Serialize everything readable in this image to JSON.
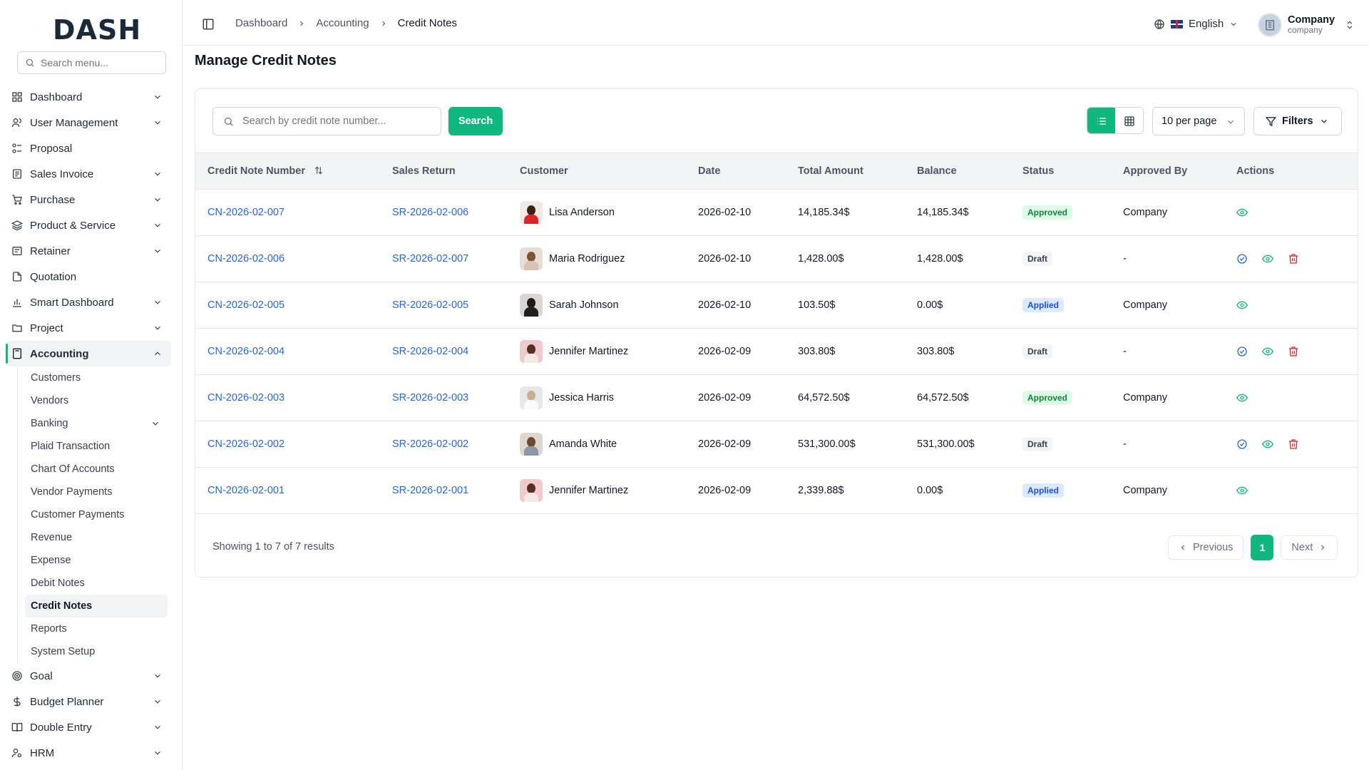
{
  "app": {
    "logo_text": "DASH"
  },
  "sidebar": {
    "search_placeholder": "Search menu...",
    "items": [
      {
        "label": "Dashboard",
        "icon": "grid-icon",
        "expandable": true
      },
      {
        "label": "User Management",
        "icon": "users-icon",
        "expandable": true
      },
      {
        "label": "Proposal",
        "icon": "proposal-icon",
        "expandable": false
      },
      {
        "label": "Sales Invoice",
        "icon": "invoice-icon",
        "expandable": true
      },
      {
        "label": "Purchase",
        "icon": "cart-icon",
        "expandable": true
      },
      {
        "label": "Product & Service",
        "icon": "layers-icon",
        "expandable": true
      },
      {
        "label": "Retainer",
        "icon": "retainer-icon",
        "expandable": true
      },
      {
        "label": "Quotation",
        "icon": "file-icon",
        "expandable": false
      },
      {
        "label": "Smart Dashboard",
        "icon": "chart-icon",
        "expandable": true
      },
      {
        "label": "Project",
        "icon": "folder-icon",
        "expandable": true
      },
      {
        "label": "Accounting",
        "icon": "calculator-icon",
        "expandable": true,
        "expanded": true
      }
    ],
    "accounting_sub": [
      {
        "label": "Customers"
      },
      {
        "label": "Vendors"
      },
      {
        "label": "Banking",
        "expandable": true
      },
      {
        "label": "Plaid Transaction"
      },
      {
        "label": "Chart Of Accounts"
      },
      {
        "label": "Vendor Payments"
      },
      {
        "label": "Customer Payments"
      },
      {
        "label": "Revenue"
      },
      {
        "label": "Expense"
      },
      {
        "label": "Debit Notes"
      },
      {
        "label": "Credit Notes",
        "active": true
      },
      {
        "label": "Reports"
      },
      {
        "label": "System Setup"
      }
    ],
    "bottom_items": [
      {
        "label": "Goal",
        "icon": "target-icon"
      },
      {
        "label": "Budget Planner",
        "icon": "dollar-icon"
      },
      {
        "label": "Double Entry",
        "icon": "book-icon"
      },
      {
        "label": "HRM",
        "icon": "hrm-icon"
      }
    ]
  },
  "header": {
    "breadcrumb": [
      "Dashboard",
      "Accounting",
      "Credit Notes"
    ],
    "language": "English",
    "company_name": "Company",
    "company_role": "company"
  },
  "main": {
    "title": "Manage Credit Notes",
    "search_placeholder": "Search by credit note number...",
    "search_button": "Search",
    "per_page": "10 per page",
    "filters_button": "Filters",
    "columns": [
      "Credit Note Number",
      "Sales Return",
      "Customer",
      "Date",
      "Total Amount",
      "Balance",
      "Status",
      "Approved By",
      "Actions"
    ],
    "rows": [
      {
        "number": "CN-2026-02-007",
        "sales_return": "SR-2026-02-006",
        "customer": "Lisa Anderson",
        "date": "2026-02-10",
        "total": "14,185.34$",
        "balance": "14,185.34$",
        "status": "Approved",
        "approved_by": "Company"
      },
      {
        "number": "CN-2026-02-006",
        "sales_return": "SR-2026-02-007",
        "customer": "Maria Rodriguez",
        "date": "2026-02-10",
        "total": "1,428.00$",
        "balance": "1,428.00$",
        "status": "Draft",
        "approved_by": "-"
      },
      {
        "number": "CN-2026-02-005",
        "sales_return": "SR-2026-02-005",
        "customer": "Sarah Johnson",
        "date": "2026-02-10",
        "total": "103.50$",
        "balance": "0.00$",
        "status": "Applied",
        "approved_by": "Company"
      },
      {
        "number": "CN-2026-02-004",
        "sales_return": "SR-2026-02-004",
        "customer": "Jennifer Martinez",
        "date": "2026-02-09",
        "total": "303.80$",
        "balance": "303.80$",
        "status": "Draft",
        "approved_by": "-"
      },
      {
        "number": "CN-2026-02-003",
        "sales_return": "SR-2026-02-003",
        "customer": "Jessica Harris",
        "date": "2026-02-09",
        "total": "64,572.50$",
        "balance": "64,572.50$",
        "status": "Approved",
        "approved_by": "Company"
      },
      {
        "number": "CN-2026-02-002",
        "sales_return": "SR-2026-02-002",
        "customer": "Amanda White",
        "date": "2026-02-09",
        "total": "531,300.00$",
        "balance": "531,300.00$",
        "status": "Draft",
        "approved_by": "-"
      },
      {
        "number": "CN-2026-02-001",
        "sales_return": "SR-2026-02-001",
        "customer": "Jennifer Martinez",
        "date": "2026-02-09",
        "total": "2,339.88$",
        "balance": "0.00$",
        "status": "Applied",
        "approved_by": "Company"
      }
    ],
    "showing_text": "Showing 1 to 7 of 7 results",
    "pagination": {
      "previous": "Previous",
      "current_page": "1",
      "next": "Next"
    }
  },
  "colors": {
    "accent": "#10b77f",
    "link": "#2563eb",
    "delete": "#dc2626"
  }
}
